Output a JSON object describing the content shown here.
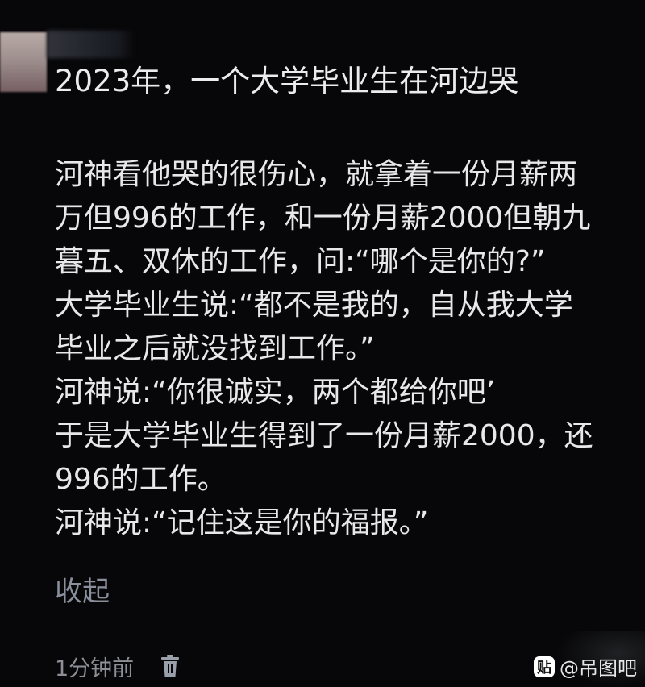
{
  "post": {
    "title": "2023年，一个大学毕业生在河边哭",
    "lines": [
      "河神看他哭的很伤心，就拿着一份月薪两",
      "万但996的工作，和一份月薪2000但朝九",
      "暮五、双休的工作，问:“哪个是你的?”",
      "大学毕业生说:“都不是我的，自从我大学",
      "毕业之后就没找到工作。”",
      "河神说:“你很诚实，两个都给你吧’",
      "于是大学毕业生得到了一份月薪2000，还",
      "996的工作。",
      "河神说:“记住这是你的福报。”"
    ],
    "collapse_label": "收起"
  },
  "meta": {
    "timestamp": "1分钟前",
    "delete_icon": "trash-icon"
  },
  "watermark": {
    "badge": "贴",
    "text": "@吊图吧"
  },
  "colors": {
    "background": "#070709",
    "text": "#e8e8ea",
    "muted": "#8a8f9c"
  }
}
